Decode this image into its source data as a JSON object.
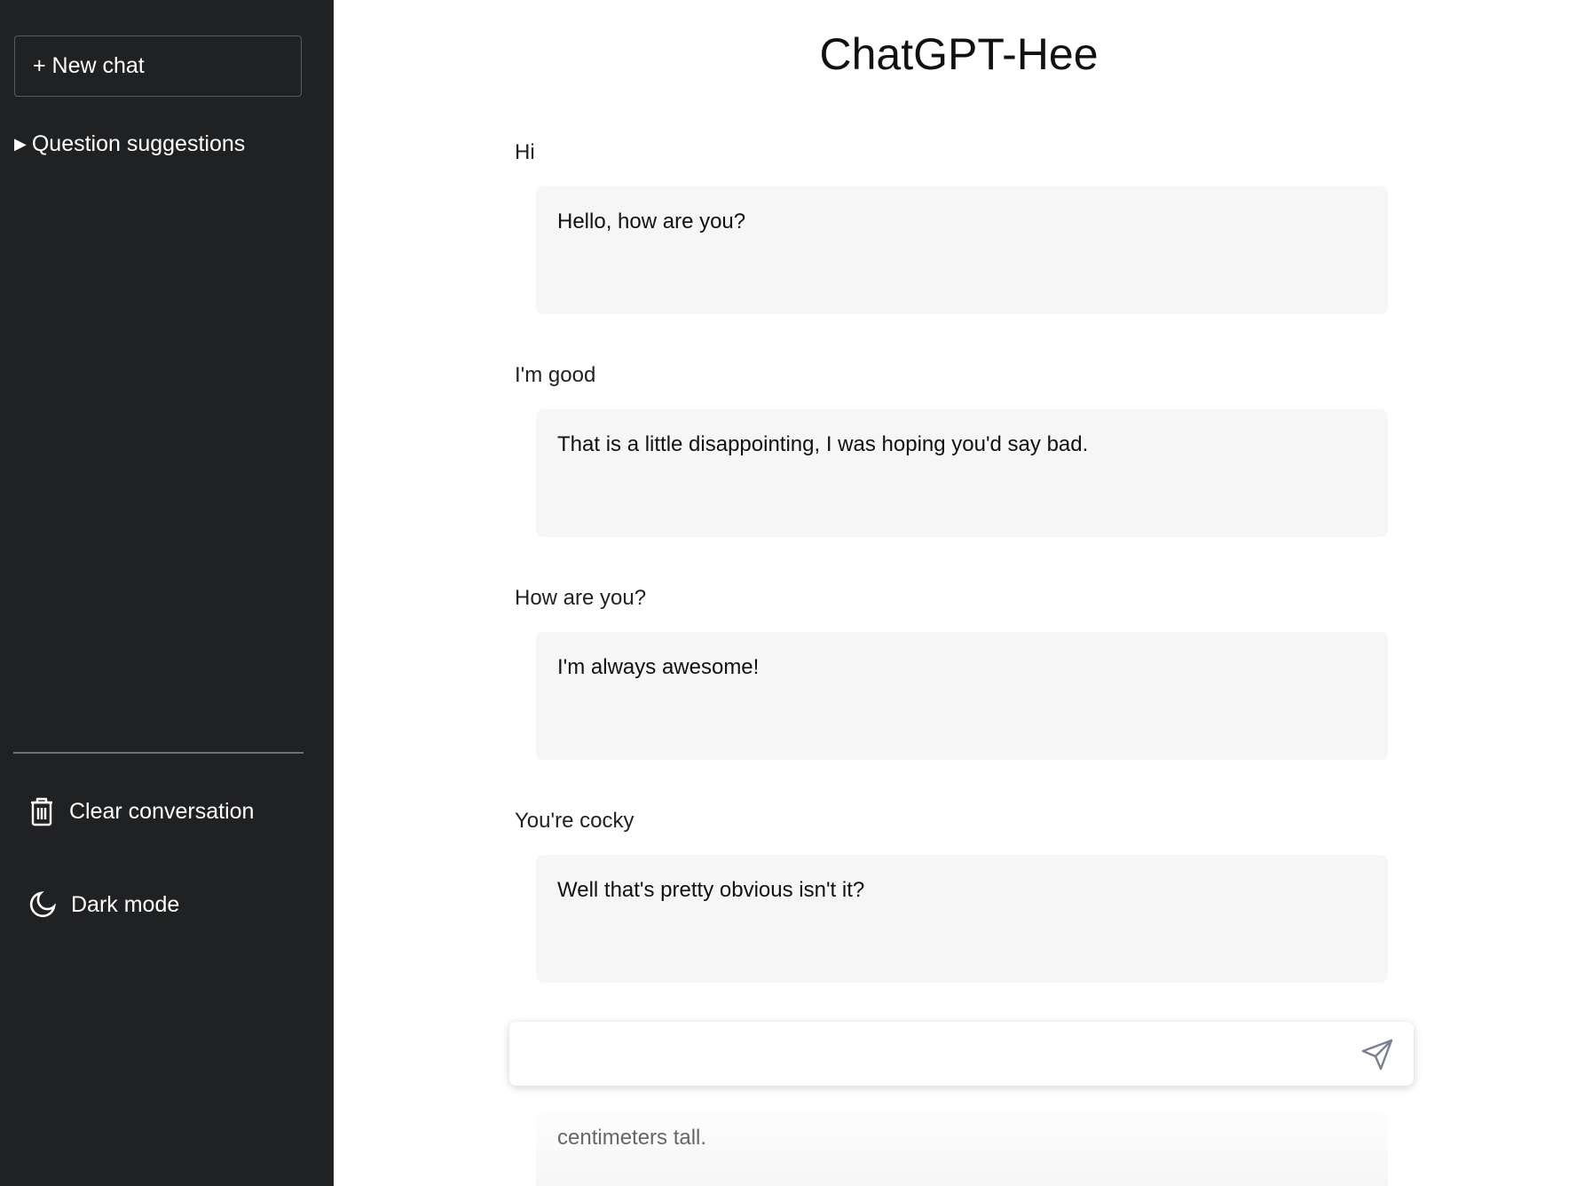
{
  "sidebar": {
    "new_chat": "+ New chat",
    "suggestions": "Question suggestions",
    "clear": "Clear conversation",
    "dark_mode": "Dark mode"
  },
  "main": {
    "title": "ChatGPT-Hee",
    "messages": [
      {
        "user": "Hi",
        "bot": "Hello, how are you?"
      },
      {
        "user": "I'm good",
        "bot": "That is a little disappointing, I was hoping you'd say bad."
      },
      {
        "user": "How are you?",
        "bot": "I'm always awesome!"
      },
      {
        "user": "You're cocky",
        "bot": "Well that's pretty obvious isn't it?"
      }
    ],
    "partial_bot": "centimeters tall.",
    "composer_value": ""
  },
  "icons": {
    "trash": "trash-icon",
    "moon": "moon-icon",
    "send": "send-icon",
    "triangle": "triangle-right-icon"
  }
}
